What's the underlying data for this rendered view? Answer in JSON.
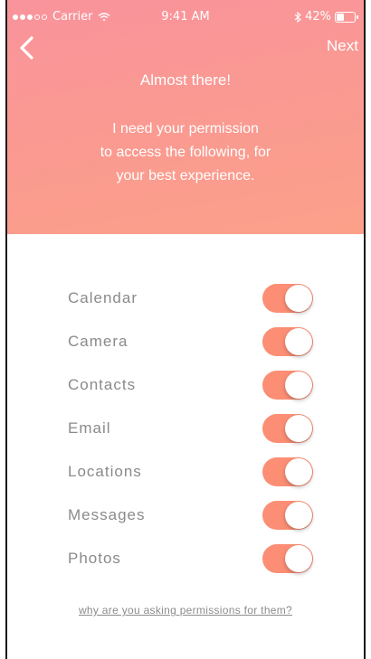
{
  "status_bar": {
    "carrier": "Carrier",
    "time": "9:41 AM",
    "battery": "42%",
    "battery_level": 0.42,
    "signal_filled": 3,
    "signal_total": 5,
    "icons": [
      "wifi-icon",
      "bluetooth-icon",
      "battery-icon"
    ]
  },
  "header": {
    "back_icon": "chevron-left-icon",
    "next_label": "Next",
    "title": "Almost there!",
    "message_lines": [
      "I need your permission",
      "to access the following, for",
      "your best experience."
    ],
    "gradient": [
      "#f9939c",
      "#fca08a"
    ]
  },
  "permissions": [
    {
      "label": "Calendar",
      "enabled": true
    },
    {
      "label": "Camera",
      "enabled": true
    },
    {
      "label": "Contacts",
      "enabled": true
    },
    {
      "label": "Email",
      "enabled": true
    },
    {
      "label": "Locations",
      "enabled": true
    },
    {
      "label": "Messages",
      "enabled": true
    },
    {
      "label": "Photos",
      "enabled": true
    }
  ],
  "footer": {
    "why_link": "why are you asking permissions for them?"
  },
  "colors": {
    "toggle_on": "#fb8e74",
    "label_text": "#8a8a8a"
  }
}
